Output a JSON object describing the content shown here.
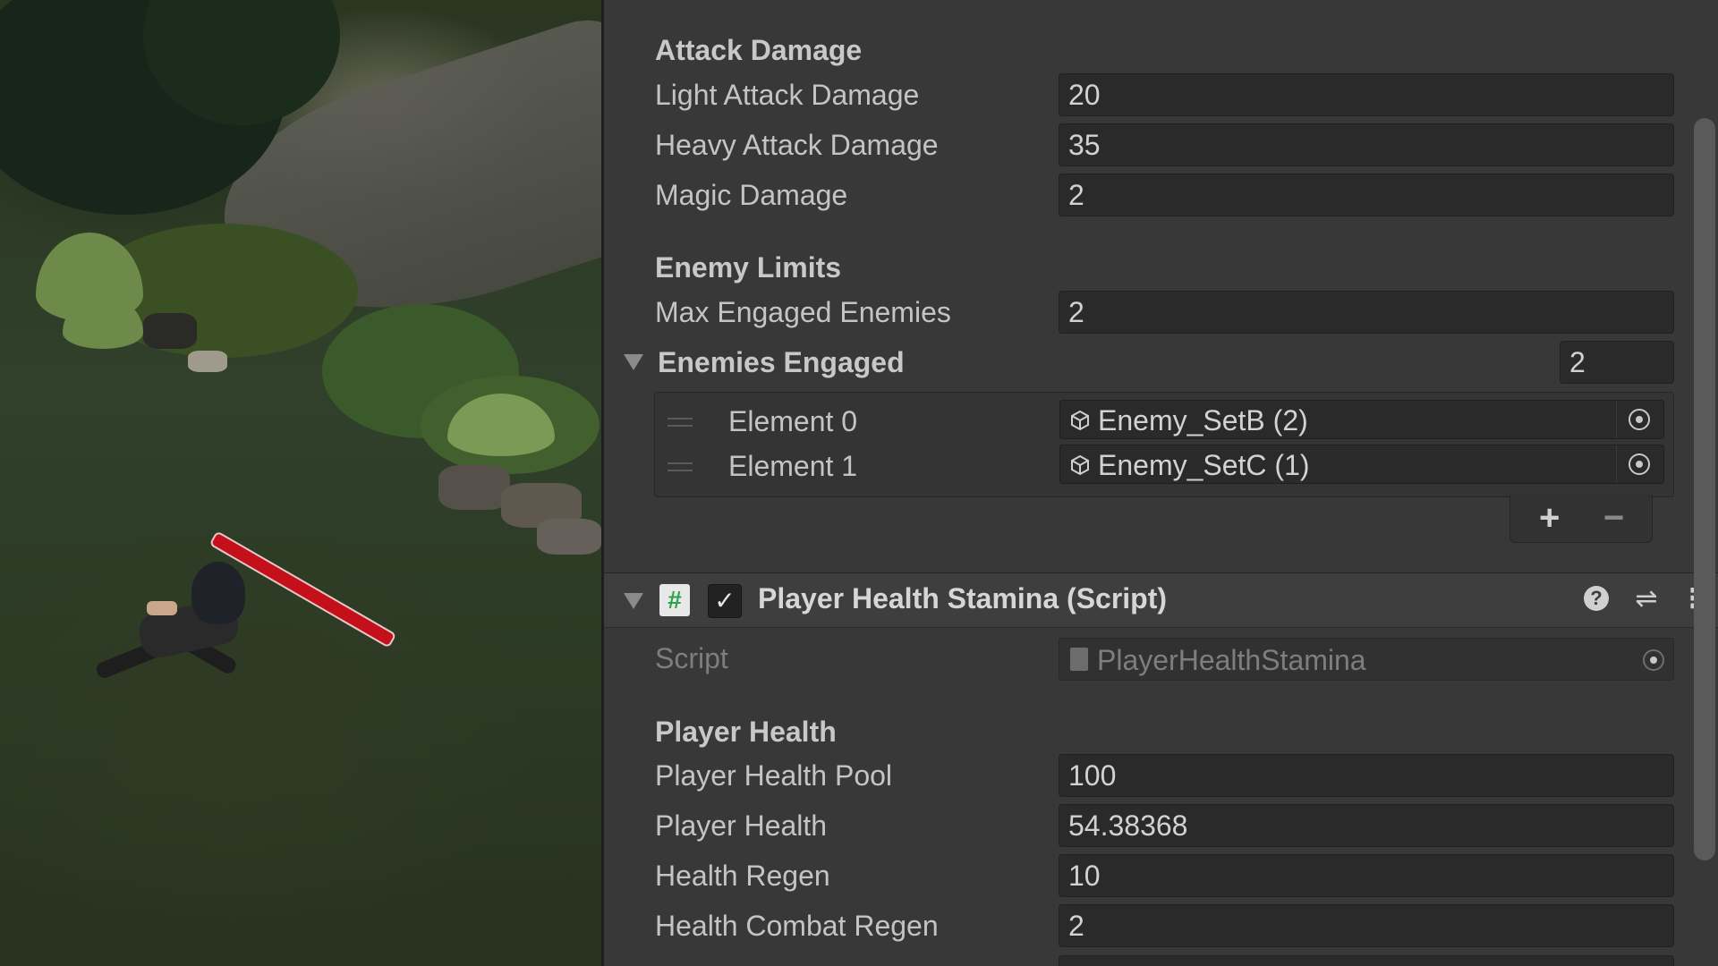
{
  "inspector": {
    "attack_damage": {
      "header": "Attack Damage",
      "light_label": "Light Attack Damage",
      "light_value": "20",
      "heavy_label": "Heavy Attack Damage",
      "heavy_value": "35",
      "magic_label": "Magic Damage",
      "magic_value": "2"
    },
    "enemy_limits": {
      "header": "Enemy Limits",
      "max_label": "Max Engaged Enemies",
      "max_value": "2",
      "engaged_label": "Enemies Engaged",
      "engaged_count": "2",
      "elements": [
        {
          "label": "Element 0",
          "value": "Enemy_SetB (2)"
        },
        {
          "label": "Element 1",
          "value": "Enemy_SetC (1)"
        }
      ],
      "add_symbol": "+",
      "remove_symbol": "−"
    },
    "component": {
      "title": "Player Health Stamina (Script)",
      "script_icon": "#",
      "enabled_check": "✓",
      "script_label": "Script",
      "script_value": "PlayerHealthStamina",
      "icons": {
        "help": "help-icon",
        "presets": "presets-icon",
        "menu": "kebab-menu-icon"
      }
    },
    "player_health": {
      "header": "Player Health",
      "pool_label": "Player Health Pool",
      "pool_value": "100",
      "health_label": "Player Health",
      "health_value": "54.38368",
      "regen_label": "Health Regen",
      "regen_value": "10",
      "combat_regen_label": "Health Combat Regen",
      "combat_regen_value": "2"
    }
  },
  "colors": {
    "inspector_bg": "#383838",
    "field_bg": "#2a2a2a",
    "aim_line": "#c4101a",
    "script_icon_green": "#2aa34a"
  }
}
